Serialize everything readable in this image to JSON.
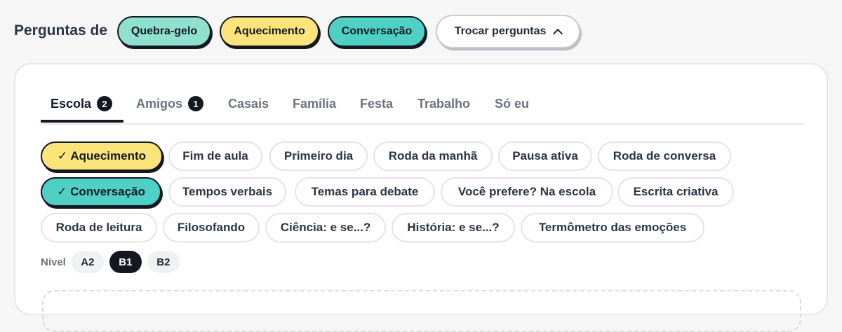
{
  "header": {
    "label": "Perguntas de",
    "pills": [
      "Quebra-gelo",
      "Aquecimento",
      "Conversação"
    ],
    "swap_button": "Trocar perguntas"
  },
  "tabs": [
    {
      "label": "Escola",
      "badge": "2",
      "active": true
    },
    {
      "label": "Amigos",
      "badge": "1"
    },
    {
      "label": "Casais"
    },
    {
      "label": "Família"
    },
    {
      "label": "Festa"
    },
    {
      "label": "Trabalho"
    },
    {
      "label": "Só eu"
    }
  ],
  "chips": [
    [
      "✓ Aquecimento",
      "Fim de aula",
      "Primeiro dia",
      "Roda da manhã",
      "Pausa ativa",
      "Roda de conversa"
    ],
    [
      "✓ Conversação",
      "Tempos verbais",
      "Temas para debate",
      "Você prefere? Na escola",
      "Escrita criativa"
    ],
    [
      "Roda de leitura",
      "Filosofando",
      "Ciência: e se...?",
      "História: e se...?",
      "Termômetro das emoções"
    ]
  ],
  "level": {
    "label": "Nível",
    "options": [
      "A2",
      "B1",
      "B2"
    ],
    "selected": "B1"
  },
  "colors": {
    "yellow": "#fbe57b",
    "teal": "#4fd0c4",
    "mint": "#8fe0cc",
    "dark": "#141821"
  }
}
